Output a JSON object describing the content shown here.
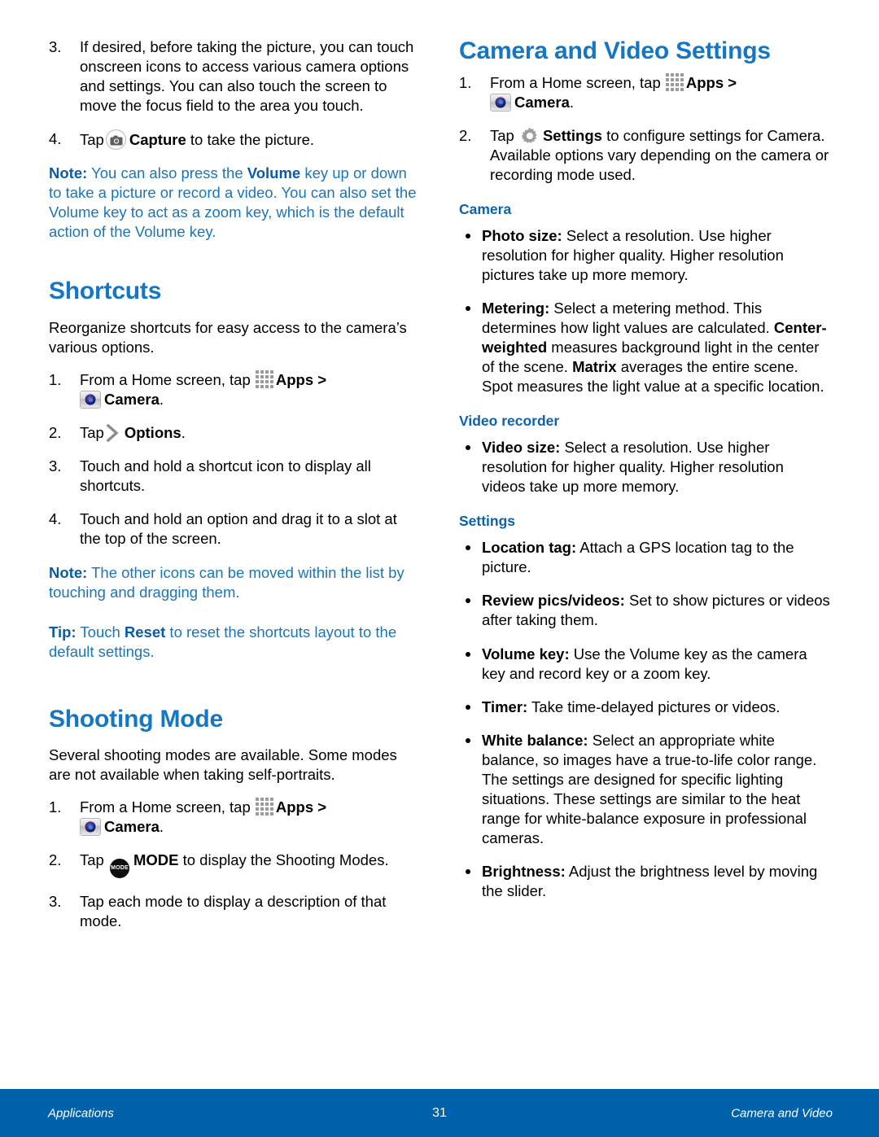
{
  "colors": {
    "heading_blue": "#1576c3",
    "subhead_blue": "#0a62b0",
    "note_blue": "#1b75bb",
    "footer_blue": "#0061ab",
    "body_black": "#000000"
  },
  "left_column": {
    "step3": {
      "num": "3.",
      "text": "If desired, before taking the picture, you can touch onscreen icons to access various camera options and settings. You can also touch the screen to move the focus field to the area you touch."
    },
    "step4": {
      "num": "4.",
      "lead": "Tap",
      "bold": "Capture",
      "tail": "to take the picture."
    },
    "note1": {
      "label": "Note",
      "colon": ":",
      "part1": " You can also press the ",
      "bold1": "Volume",
      "part2": " key up or down to take a picture or record a video. You can also set the Volume key to act as a zoom key, which is the default action of the Volume key."
    },
    "shortcuts": {
      "title": "Shortcuts",
      "intro": "Reorganize shortcuts for easy access to the camera’s various options.",
      "step1": {
        "num": "1.",
        "lead": "From a Home screen, tap",
        "apps_label": "Apps",
        "arrow": ">",
        "camera_label": "Camera",
        "period": "."
      },
      "step2": {
        "num": "2.",
        "lead": "Tap",
        "bold": "Options",
        "period": "."
      },
      "step3": {
        "num": "3.",
        "text": "Touch and hold a shortcut icon to display all shortcuts."
      },
      "step4": {
        "num": "4.",
        "text": "Touch and hold an option and drag it to a slot at the top of the screen."
      },
      "note": {
        "label": "Note",
        "colon": ":",
        "text": " The other icons can be moved within the list by touching and dragging them."
      },
      "tip": {
        "label": "Tip",
        "colon": ":",
        "part1": " Touch ",
        "bold1": "Reset",
        "part2": " to reset the shortcuts layout to the default settings."
      }
    },
    "shooting_mode": {
      "title": "Shooting Mode",
      "intro": "Several shooting modes are available. Some modes are not available when taking self-portraits.",
      "step1": {
        "num": "1.",
        "lead": "From a Home screen, tap",
        "apps_label": "Apps",
        "arrow": ">",
        "camera_label": "Camera",
        "period": "."
      },
      "step2": {
        "num": "2.",
        "lead": "Tap",
        "icon_text": "MODE",
        "bold": "MODE",
        "tail": "to display the Shooting Modes."
      },
      "step3": {
        "num": "3.",
        "text": "Tap each mode to display a description of that mode."
      }
    }
  },
  "right_column": {
    "title": "Camera and Video Settings",
    "step1": {
      "num": "1.",
      "lead": "From a Home screen, tap",
      "apps_label": "Apps",
      "arrow": ">",
      "camera_label": "Camera",
      "period": "."
    },
    "step2": {
      "num": "2.",
      "lead": "Tap",
      "bold": "Settings",
      "tail": "to configure settings for Camera. Available options vary depending on the camera or recording mode used."
    },
    "subhead_camera": "Camera",
    "camera_bullets": [
      {
        "term": "Photo size",
        "colon": ":",
        "text": " Select a resolution. Use higher resolution for higher quality. Higher resolution pictures take up more memory."
      }
    ],
    "metering_bullet": {
      "term": "Metering",
      "colon": ":",
      "p1": " Select a metering method. This determines how light values are calculated. ",
      "b1": "Center-weighted",
      "p2": " measures background light in the center of the scene. ",
      "b2": "Matrix",
      "p3": " averages the entire scene. Spot measures the light value at a specific location."
    },
    "subhead_video_recorder": "Video recorder",
    "video_bullets": [
      {
        "term": "Video size",
        "colon": ":",
        "text": " Select a resolution. Use higher resolution for higher quality. Higher resolution videos take up more memory."
      }
    ],
    "subhead_settings": "Settings",
    "settings_bullets": [
      {
        "term": "Location tag",
        "colon": ":",
        "text": " Attach a GPS location tag to the picture."
      },
      {
        "term": "Review pics/videos",
        "colon": ":",
        "text": " Set to show pictures or videos after taking them."
      },
      {
        "term": "Volume key",
        "colon": ":",
        "text": " Use the Volume key as the camera key and record key or a zoom key."
      },
      {
        "term": "Timer",
        "colon": ":",
        "text": " Take time-delayed pictures or videos."
      },
      {
        "term": "White balance",
        "colon": ":",
        "text": " Select an appropriate white balance, so images have a true-to-life color range. The settings are designed for specific lighting situations. These settings are similar to the heat range for white-balance exposure in professional cameras."
      },
      {
        "term": "Brightness",
        "colon": ":",
        "text": " Adjust the brightness level by moving the slider."
      }
    ]
  },
  "footer": {
    "left": "Applications",
    "page_number": "31",
    "right": "Camera and Video"
  }
}
